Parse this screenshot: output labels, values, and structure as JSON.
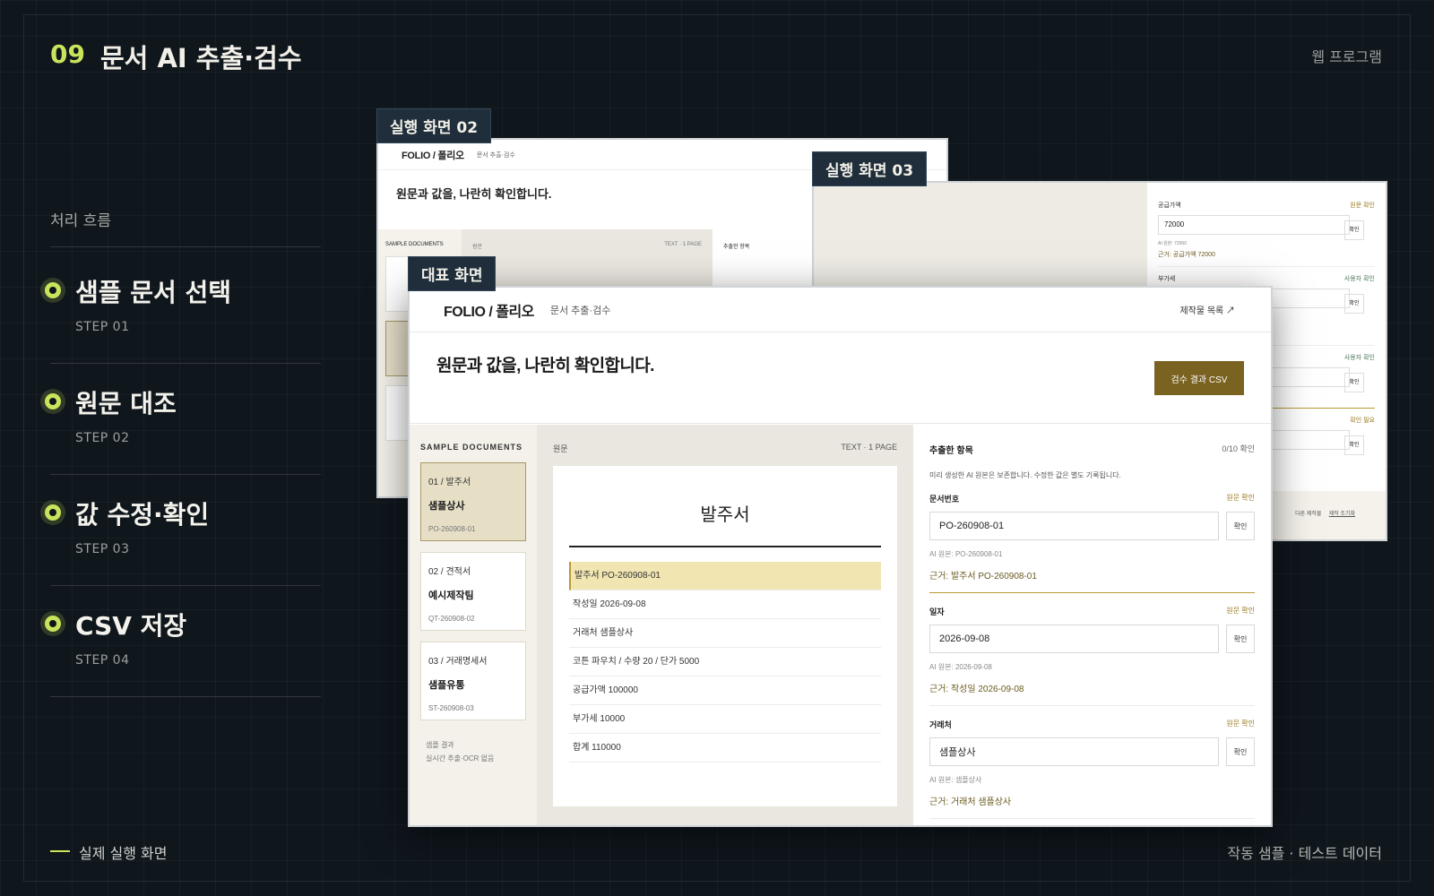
{
  "header": {
    "number": "09",
    "title": "문서 AI 추출·검수",
    "category": "웹 프로그램"
  },
  "flow": {
    "label": "처리 흐름",
    "steps": [
      {
        "name": "샘플 문서 선택",
        "sub": "STEP 01"
      },
      {
        "name": "원문 대조",
        "sub": "STEP 02"
      },
      {
        "name": "값 수정·확인",
        "sub": "STEP 03"
      },
      {
        "name": "CSV 저장",
        "sub": "STEP 04"
      }
    ]
  },
  "footer": {
    "left": "실제 실행 화면",
    "right": "작동 샘플 · 테스트 데이터"
  },
  "tags": {
    "screen02": "실행 화면 02",
    "screen03": "실행 화면 03",
    "main": "대표 화면"
  },
  "screen02": {
    "brand": "FOLIO / 폴리오",
    "brand_sub": "문서 추출·검수",
    "hero": "원문과 값을, 나란히 확인합니다.",
    "sidebar_label": "SAMPLE DOCUMENTS",
    "middle_label": "원문",
    "middle_right": "TEXT · 1 PAGE",
    "right_label": "추출한 항목"
  },
  "screen03": {
    "fields": [
      {
        "label": "공급가액",
        "status": "원문 확인",
        "value": "72000"
      },
      {
        "label": "부가세",
        "status": "사용자 확인",
        "value": ""
      },
      {
        "label": "",
        "status": "사용자 확인",
        "value": ""
      },
      {
        "label": "",
        "status": "확인 필요",
        "value": ""
      }
    ],
    "orig": "AI 원본: 72000",
    "basis": "근거: 공급가액 72000",
    "confirm": "확인",
    "footer_a": "다른 제작물",
    "footer_b": "제작 조기화"
  },
  "main": {
    "brand": "FOLIO / 폴리오",
    "brand_sub": "문서 추출·검수",
    "list_link": "제작물 목록 ↗",
    "hero": "원문과 값을, 나란히 확인합니다.",
    "csv_button": "검수 결과 CSV",
    "sidebar": {
      "label": "SAMPLE DOCUMENTS",
      "cards": [
        {
          "l1": "01 / 발주서",
          "l2": "샘플상사",
          "l3": "PO-260908-01"
        },
        {
          "l1": "02 / 견적서",
          "l2": "예시제작팀",
          "l3": "QT-260908-02"
        },
        {
          "l1": "03 / 거래명세서",
          "l2": "샘플유통",
          "l3": "ST-260908-03"
        }
      ],
      "note1": "샘플 결과",
      "note2": "실시간 추출·OCR 없음"
    },
    "middle": {
      "label": "원문",
      "right": "TEXT · 1 PAGE",
      "doc_title": "발주서",
      "rows": [
        "발주서 PO-260908-01",
        "작성일 2026-09-08",
        "거래처 샘플상사",
        "코튼 파우치 / 수량 20 / 단가 5000",
        "공급가액 100000",
        "부가세 10000",
        "합계 110000"
      ]
    },
    "right": {
      "label": "추출한 항목",
      "count": "0/10 확인",
      "desc": "미리 생성한 AI 원본은 보존합니다. 수정한 값은 별도 기록됩니다.",
      "confirm": "확인",
      "fields": [
        {
          "label": "문서번호",
          "status": "원문 확인",
          "value": "PO-260908-01",
          "orig": "AI 원본: PO-260908-01",
          "basis": "근거: 발주서 PO-260908-01"
        },
        {
          "label": "일자",
          "status": "원문 확인",
          "value": "2026-09-08",
          "orig": "AI 원본: 2026-09-08",
          "basis": "근거: 작성일 2026-09-08"
        },
        {
          "label": "거래처",
          "status": "원문 확인",
          "value": "샘플상사",
          "orig": "AI 원본: 샘플상사",
          "basis": "근거: 거래처 샘플상사"
        }
      ]
    }
  },
  "colors": {
    "accent": "#c9e45c",
    "brand_button": "#7a6220",
    "background": "#0f161c"
  }
}
